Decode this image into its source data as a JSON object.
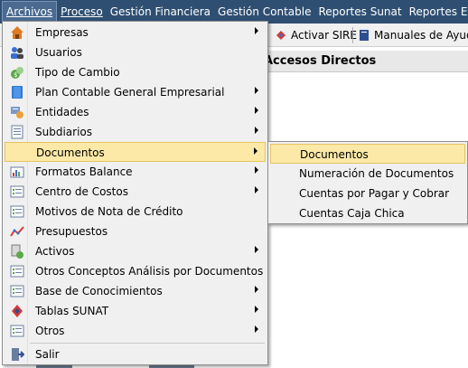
{
  "menubar": {
    "items": [
      {
        "label": "Archivos",
        "active": true
      },
      {
        "label": "Proceso",
        "active": false
      },
      {
        "label": "Gestión Financiera",
        "active": false
      },
      {
        "label": "Gestión Contable",
        "active": false
      },
      {
        "label": "Reportes Sunat",
        "active": false
      },
      {
        "label": "Reportes Enterp",
        "active": false
      }
    ]
  },
  "toolbar": {
    "activar_sire": "Activar SIRE",
    "manuales": "Manuales de Ayuda"
  },
  "panel": {
    "title": "Accesos Directos"
  },
  "menu": {
    "items": [
      {
        "label": "Empresas",
        "icon": "home-icon",
        "submenu": true
      },
      {
        "label": "Usuarios",
        "icon": "users-icon",
        "submenu": false
      },
      {
        "label": "Tipo de Cambio",
        "icon": "exchange-icon",
        "submenu": false
      },
      {
        "label": "Plan Contable General Empresarial",
        "icon": "book-icon",
        "submenu": true
      },
      {
        "label": "Entidades",
        "icon": "entities-icon",
        "submenu": true
      },
      {
        "label": "Subdiarios",
        "icon": "journal-icon",
        "submenu": true
      },
      {
        "label": "Documentos",
        "icon": "",
        "submenu": true
      },
      {
        "label": "Formatos Balance",
        "icon": "balance-icon",
        "submenu": true
      },
      {
        "label": "Centro de Costos",
        "icon": "list-icon",
        "submenu": true
      },
      {
        "label": "Motivos de Nota de Crédito",
        "icon": "list-icon",
        "submenu": false
      },
      {
        "label": "Presupuestos",
        "icon": "chart-icon",
        "submenu": false
      },
      {
        "label": "Activos",
        "icon": "assets-icon",
        "submenu": true
      },
      {
        "label": "Otros Conceptos Análisis por Documentos",
        "icon": "list-icon",
        "submenu": false
      },
      {
        "label": "Base de Conocimientos",
        "icon": "list-icon",
        "submenu": true
      },
      {
        "label": "Tablas SUNAT",
        "icon": "sunat-icon",
        "submenu": true
      },
      {
        "label": "Otros",
        "icon": "list-icon",
        "submenu": true
      },
      {
        "label": "Salir",
        "icon": "exit-icon",
        "submenu": false
      }
    ],
    "highlighted": "Documentos"
  },
  "submenu": {
    "items": [
      {
        "label": "Documentos"
      },
      {
        "label": "Numeración de Documentos"
      },
      {
        "label": "Cuentas por Pagar y Cobrar"
      },
      {
        "label": "Cuentas Caja Chica"
      }
    ],
    "highlighted": "Documentos"
  },
  "colors": {
    "menubar_bg": "#2f4f72",
    "highlight_bg": "#fce9a8",
    "highlight_border": "#e6c35c",
    "menu_bg": "#f0f0f0"
  }
}
